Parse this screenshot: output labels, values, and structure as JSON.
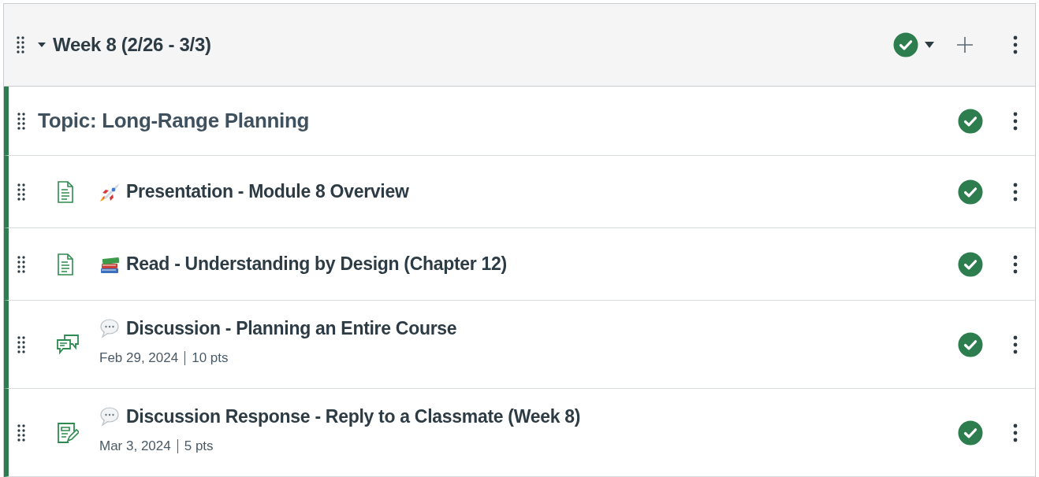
{
  "module": {
    "title": "Week 8 (2/26 - 3/3)",
    "expanded": true,
    "published": true
  },
  "items": [
    {
      "kind": "header",
      "title": "Topic: Long-Range Planning",
      "published": true
    },
    {
      "kind": "page",
      "emoji": {
        "kind": "rocket"
      },
      "title": "Presentation - Module 8 Overview",
      "published": true
    },
    {
      "kind": "page",
      "emoji": {
        "kind": "books"
      },
      "title": "Read - Understanding by Design (Chapter 12)",
      "published": true
    },
    {
      "kind": "discussion",
      "emoji": {
        "kind": "speech"
      },
      "title": "Discussion - Planning an Entire Course",
      "date": "Feb 29, 2024",
      "points": "10 pts",
      "published": true
    },
    {
      "kind": "assignment",
      "emoji": {
        "kind": "speech"
      },
      "title": "Discussion Response - Reply to a Classmate (Week 8)",
      "date": "Mar 3, 2024",
      "points": "5 pts",
      "published": true
    }
  ]
}
